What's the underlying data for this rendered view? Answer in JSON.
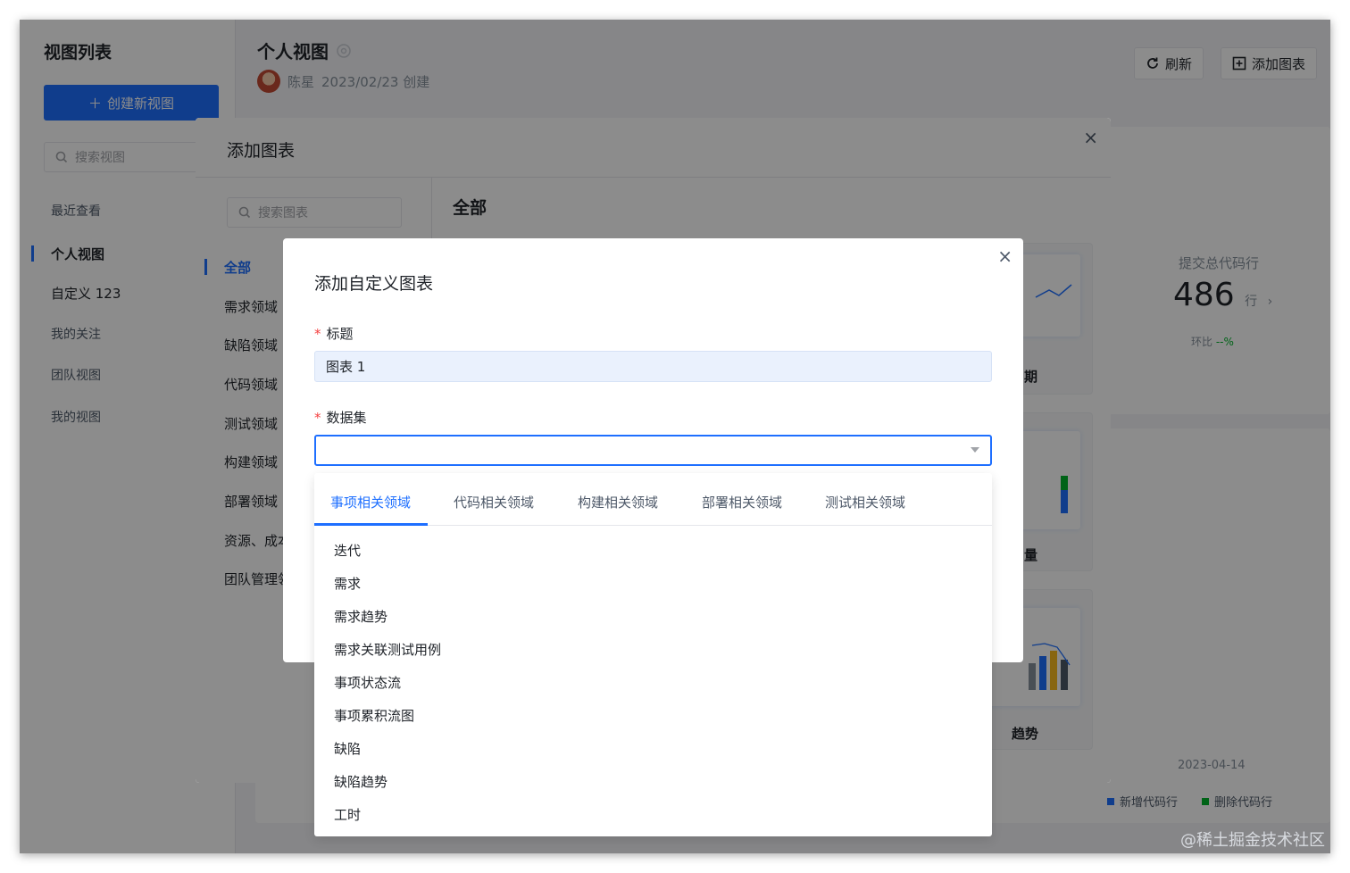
{
  "sidebar": {
    "title": "视图列表",
    "create_button": "创建新视图",
    "search_placeholder": "搜索视图",
    "items": [
      {
        "label": "最近查看"
      },
      {
        "label": "个人视图"
      },
      {
        "label": "自定义 123"
      },
      {
        "label": "我的关注"
      },
      {
        "label": "团队视图"
      },
      {
        "label": "我的视图"
      }
    ]
  },
  "header": {
    "title": "个人视图",
    "author": "陈星",
    "created": "2023/02/23 创建",
    "refresh_button": "刷新",
    "add_chart_button": "添加图表"
  },
  "background": {
    "stat_label": "提交总代码行",
    "stat_value": "486",
    "stat_unit": "行",
    "stat_sub_label": "环比",
    "stat_sub_value": "--%",
    "date": "2023-04-14",
    "legend": [
      "新增代码行",
      "删除代码行"
    ],
    "legend_colors": [
      "#1e6fff",
      "#00b42a"
    ]
  },
  "add_chart_modal": {
    "title": "添加图表",
    "search_placeholder": "搜索图表",
    "heading": "全部",
    "categories": [
      "全部",
      "需求领域",
      "缺陷领域",
      "代码领域",
      "测试领域",
      "构建领域",
      "部署领域",
      "资源、成本",
      "团队管理领域"
    ],
    "card_labels": [
      "期",
      "量",
      "趋势"
    ]
  },
  "custom_chart_modal": {
    "title": "添加自定义图表",
    "title_field_label": "标题",
    "title_field_value": "图表 1",
    "dataset_field_label": "数据集",
    "dataset_value": ""
  },
  "dropdown": {
    "tabs": [
      "事项相关领域",
      "代码相关领域",
      "构建相关领域",
      "部署相关领域",
      "测试相关领域"
    ],
    "active_tab": "事项相关领域",
    "options": [
      "迭代",
      "需求",
      "需求趋势",
      "需求关联测试用例",
      "事项状态流",
      "事项累积流图",
      "缺陷",
      "缺陷趋势",
      "工时"
    ]
  },
  "watermark": "@稀土掘金技术社区",
  "colors": {
    "accent": "#1e6fff",
    "required": "#f53f3f"
  }
}
